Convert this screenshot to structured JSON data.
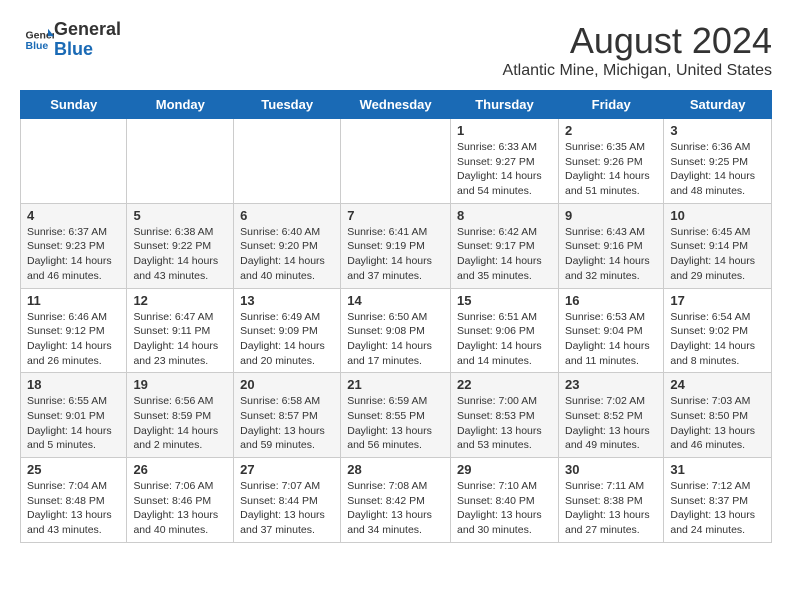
{
  "logo": {
    "general": "General",
    "blue": "Blue"
  },
  "title": "August 2024",
  "location": "Atlantic Mine, Michigan, United States",
  "days_of_week": [
    "Sunday",
    "Monday",
    "Tuesday",
    "Wednesday",
    "Thursday",
    "Friday",
    "Saturday"
  ],
  "weeks": [
    [
      {
        "day": "",
        "info": ""
      },
      {
        "day": "",
        "info": ""
      },
      {
        "day": "",
        "info": ""
      },
      {
        "day": "",
        "info": ""
      },
      {
        "day": "1",
        "info": "Sunrise: 6:33 AM\nSunset: 9:27 PM\nDaylight: 14 hours\nand 54 minutes."
      },
      {
        "day": "2",
        "info": "Sunrise: 6:35 AM\nSunset: 9:26 PM\nDaylight: 14 hours\nand 51 minutes."
      },
      {
        "day": "3",
        "info": "Sunrise: 6:36 AM\nSunset: 9:25 PM\nDaylight: 14 hours\nand 48 minutes."
      }
    ],
    [
      {
        "day": "4",
        "info": "Sunrise: 6:37 AM\nSunset: 9:23 PM\nDaylight: 14 hours\nand 46 minutes."
      },
      {
        "day": "5",
        "info": "Sunrise: 6:38 AM\nSunset: 9:22 PM\nDaylight: 14 hours\nand 43 minutes."
      },
      {
        "day": "6",
        "info": "Sunrise: 6:40 AM\nSunset: 9:20 PM\nDaylight: 14 hours\nand 40 minutes."
      },
      {
        "day": "7",
        "info": "Sunrise: 6:41 AM\nSunset: 9:19 PM\nDaylight: 14 hours\nand 37 minutes."
      },
      {
        "day": "8",
        "info": "Sunrise: 6:42 AM\nSunset: 9:17 PM\nDaylight: 14 hours\nand 35 minutes."
      },
      {
        "day": "9",
        "info": "Sunrise: 6:43 AM\nSunset: 9:16 PM\nDaylight: 14 hours\nand 32 minutes."
      },
      {
        "day": "10",
        "info": "Sunrise: 6:45 AM\nSunset: 9:14 PM\nDaylight: 14 hours\nand 29 minutes."
      }
    ],
    [
      {
        "day": "11",
        "info": "Sunrise: 6:46 AM\nSunset: 9:12 PM\nDaylight: 14 hours\nand 26 minutes."
      },
      {
        "day": "12",
        "info": "Sunrise: 6:47 AM\nSunset: 9:11 PM\nDaylight: 14 hours\nand 23 minutes."
      },
      {
        "day": "13",
        "info": "Sunrise: 6:49 AM\nSunset: 9:09 PM\nDaylight: 14 hours\nand 20 minutes."
      },
      {
        "day": "14",
        "info": "Sunrise: 6:50 AM\nSunset: 9:08 PM\nDaylight: 14 hours\nand 17 minutes."
      },
      {
        "day": "15",
        "info": "Sunrise: 6:51 AM\nSunset: 9:06 PM\nDaylight: 14 hours\nand 14 minutes."
      },
      {
        "day": "16",
        "info": "Sunrise: 6:53 AM\nSunset: 9:04 PM\nDaylight: 14 hours\nand 11 minutes."
      },
      {
        "day": "17",
        "info": "Sunrise: 6:54 AM\nSunset: 9:02 PM\nDaylight: 14 hours\nand 8 minutes."
      }
    ],
    [
      {
        "day": "18",
        "info": "Sunrise: 6:55 AM\nSunset: 9:01 PM\nDaylight: 14 hours\nand 5 minutes."
      },
      {
        "day": "19",
        "info": "Sunrise: 6:56 AM\nSunset: 8:59 PM\nDaylight: 14 hours\nand 2 minutes."
      },
      {
        "day": "20",
        "info": "Sunrise: 6:58 AM\nSunset: 8:57 PM\nDaylight: 13 hours\nand 59 minutes."
      },
      {
        "day": "21",
        "info": "Sunrise: 6:59 AM\nSunset: 8:55 PM\nDaylight: 13 hours\nand 56 minutes."
      },
      {
        "day": "22",
        "info": "Sunrise: 7:00 AM\nSunset: 8:53 PM\nDaylight: 13 hours\nand 53 minutes."
      },
      {
        "day": "23",
        "info": "Sunrise: 7:02 AM\nSunset: 8:52 PM\nDaylight: 13 hours\nand 49 minutes."
      },
      {
        "day": "24",
        "info": "Sunrise: 7:03 AM\nSunset: 8:50 PM\nDaylight: 13 hours\nand 46 minutes."
      }
    ],
    [
      {
        "day": "25",
        "info": "Sunrise: 7:04 AM\nSunset: 8:48 PM\nDaylight: 13 hours\nand 43 minutes."
      },
      {
        "day": "26",
        "info": "Sunrise: 7:06 AM\nSunset: 8:46 PM\nDaylight: 13 hours\nand 40 minutes."
      },
      {
        "day": "27",
        "info": "Sunrise: 7:07 AM\nSunset: 8:44 PM\nDaylight: 13 hours\nand 37 minutes."
      },
      {
        "day": "28",
        "info": "Sunrise: 7:08 AM\nSunset: 8:42 PM\nDaylight: 13 hours\nand 34 minutes."
      },
      {
        "day": "29",
        "info": "Sunrise: 7:10 AM\nSunset: 8:40 PM\nDaylight: 13 hours\nand 30 minutes."
      },
      {
        "day": "30",
        "info": "Sunrise: 7:11 AM\nSunset: 8:38 PM\nDaylight: 13 hours\nand 27 minutes."
      },
      {
        "day": "31",
        "info": "Sunrise: 7:12 AM\nSunset: 8:37 PM\nDaylight: 13 hours\nand 24 minutes."
      }
    ]
  ]
}
